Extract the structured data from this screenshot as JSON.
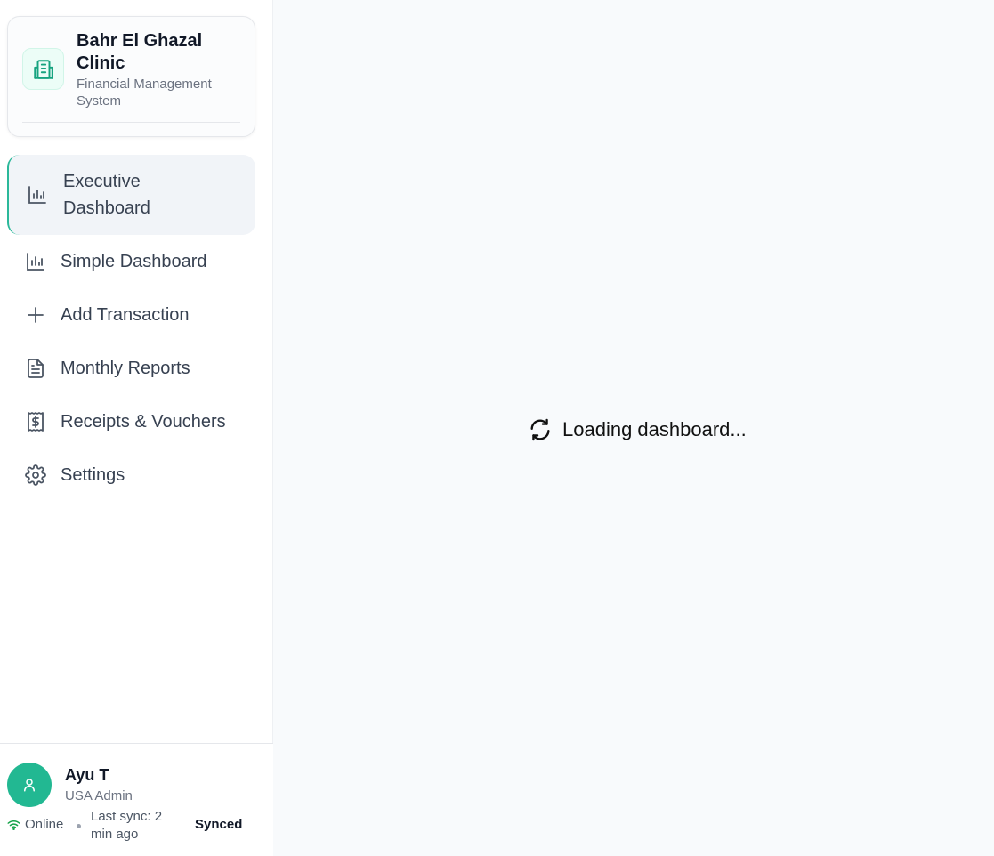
{
  "brand": {
    "title": "Bahr El Ghazal Clinic",
    "subtitle": "Financial Management System",
    "logo_icon": "hospital-building-icon"
  },
  "nav": {
    "items": [
      {
        "label": "Executive Dashboard",
        "icon": "bar-chart-icon",
        "active": true
      },
      {
        "label": "Simple Dashboard",
        "icon": "bar-chart-icon",
        "active": false
      },
      {
        "label": "Add Transaction",
        "icon": "plus-icon",
        "active": false
      },
      {
        "label": "Monthly Reports",
        "icon": "file-text-icon",
        "active": false
      },
      {
        "label": "Receipts & Vouchers",
        "icon": "receipt-icon",
        "active": false
      },
      {
        "label": "Settings",
        "icon": "gear-icon",
        "active": false
      }
    ]
  },
  "user": {
    "name": "Ayu T",
    "role": "USA Admin",
    "connection": "Online",
    "last_sync": "Last sync: 2 min ago",
    "sync_status": "Synced"
  },
  "main": {
    "loading_text": "Loading dashboard..."
  },
  "colors": {
    "accent": "#22b892",
    "active_bg": "#f1f4f8",
    "page_bg": "#f8fafc"
  }
}
